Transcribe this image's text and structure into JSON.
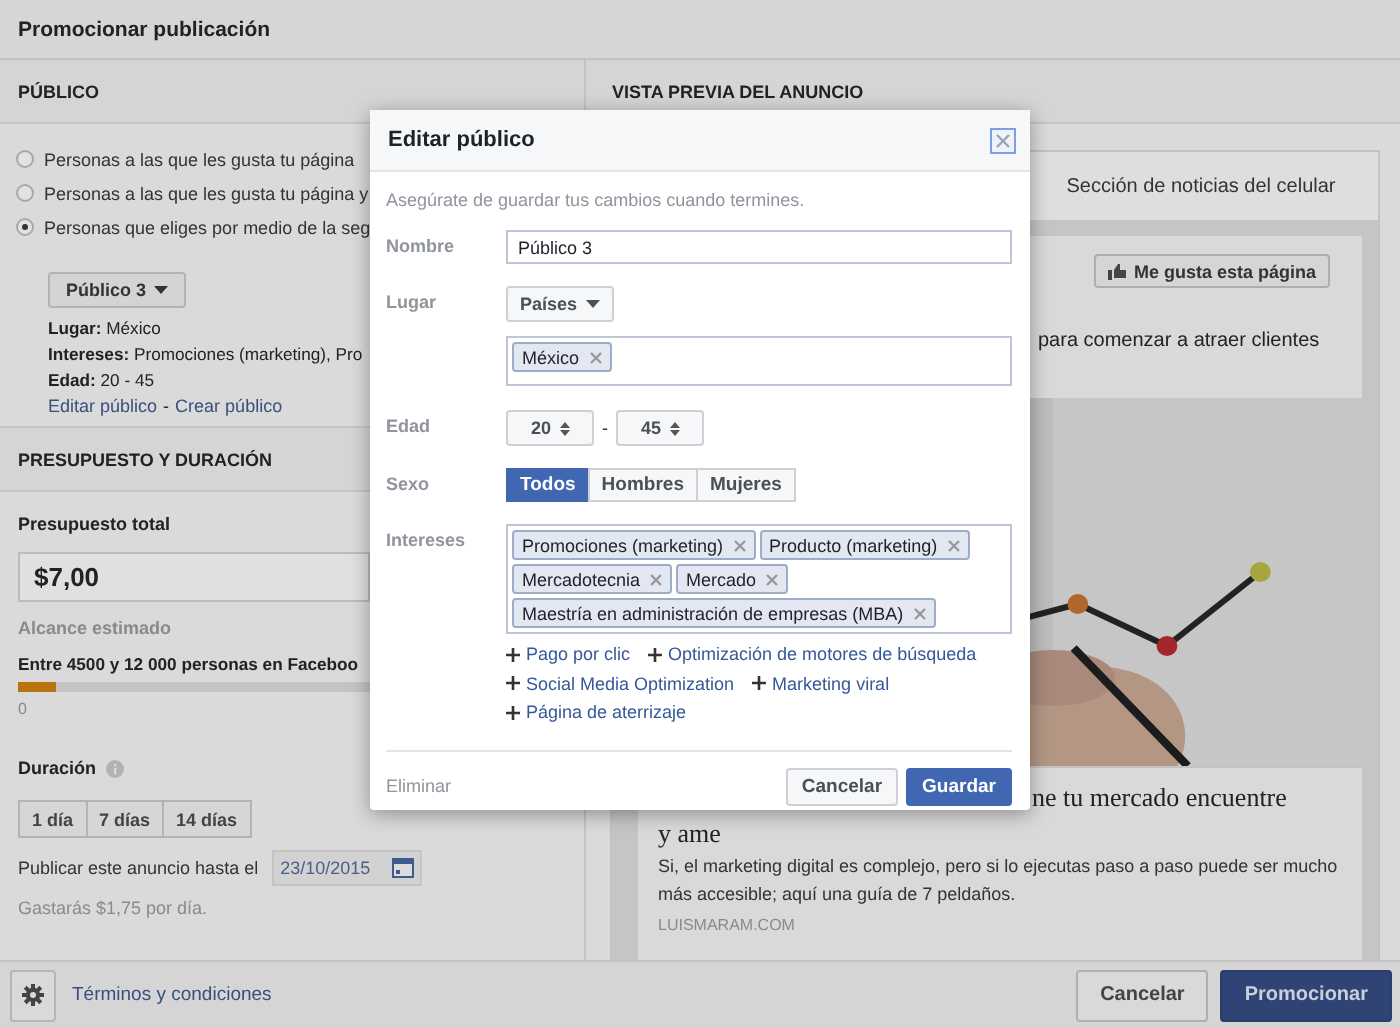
{
  "window": {
    "title": "Promocionar publicación"
  },
  "audience": {
    "heading": "PÚBLICO",
    "options": [
      {
        "label": "Personas a las que les gusta tu página",
        "selected": false
      },
      {
        "label": "Personas a las que les gusta tu página y",
        "selected": false
      },
      {
        "label": "Personas que eliges por medio de la seg",
        "selected": true
      }
    ],
    "audience_button": "Público 3",
    "summary": [
      "**Lugar:** México",
      "**Intereses:** Promociones (marketing), Pro",
      "**Edad:** 20 - 45"
    ],
    "links": [
      "Editar público",
      "Crear público"
    ],
    "link_separator": "-"
  },
  "budget": {
    "heading": "PRESUPUESTO Y DURACIÓN",
    "total_label": "Presupuesto total",
    "total_value": "$7,00",
    "reach_label": "Alcance estimado",
    "reach_text": "Entre 4500 y 12 000 personas en Faceboo",
    "reach": {
      "level": 0.07
    },
    "reach_min": "0",
    "duration_label": "Duración",
    "durations": [
      "1 día",
      "7 días",
      "14 días"
    ],
    "end_label": "Publicar este anuncio hasta el",
    "end_date": "23/10/2015",
    "daily_note": "Gastarás $1,75 por día."
  },
  "preview": {
    "heading": "VISTA PREVIA DEL ANUNCIO",
    "tabs": [
      {
        "label": "Sección de noticias del celular",
        "selected": true
      }
    ],
    "like_button": "Me gusta esta página",
    "post_text": "para comenzar a atraer clientes",
    "title_lines": [
      "ne tu mercado encuentre",
      "y ame"
    ],
    "description": "Si, el marketing digital es complejo, pero si lo ejecutas paso a paso puede ser mucho más accesible; aquí una guía de 7 peldaños.",
    "domain": "LUISMARAM.COM"
  },
  "footer": {
    "terms_link": "Términos y condiciones",
    "buttons": [
      {
        "label": "Cancelar",
        "kind": "secondary"
      },
      {
        "label": "Promocionar",
        "kind": "primary"
      }
    ]
  },
  "dialog": {
    "title": "Editar público",
    "hint": "Asegúrate de guardar tus cambios cuando termines.",
    "name_label": "Nombre",
    "name_value": "Público 3",
    "place_label": "Lugar",
    "place_type": "Países",
    "places": [
      "México"
    ],
    "age_label": "Edad",
    "age_min": "20",
    "age_separator": "-",
    "age_max": "45",
    "gender_label": "Sexo",
    "genders": [
      {
        "label": "Todos",
        "selected": true
      },
      {
        "label": "Hombres",
        "selected": false
      },
      {
        "label": "Mujeres",
        "selected": false
      }
    ],
    "interests_label": "Intereses",
    "interests": [
      "Promociones (marketing)",
      "Producto (marketing)",
      "Mercadotecnia",
      "Mercado",
      "Maestría en administración de empresas (MBA)"
    ],
    "suggestions": [
      "Pago por clic",
      "Optimización de motores de búsqueda",
      "Social Media Optimization",
      "Marketing viral",
      "Página de aterrizaje"
    ],
    "delete_link": "Eliminar",
    "buttons": [
      {
        "label": "Cancelar",
        "kind": "secondary"
      },
      {
        "label": "Guardar",
        "kind": "primary"
      }
    ]
  }
}
